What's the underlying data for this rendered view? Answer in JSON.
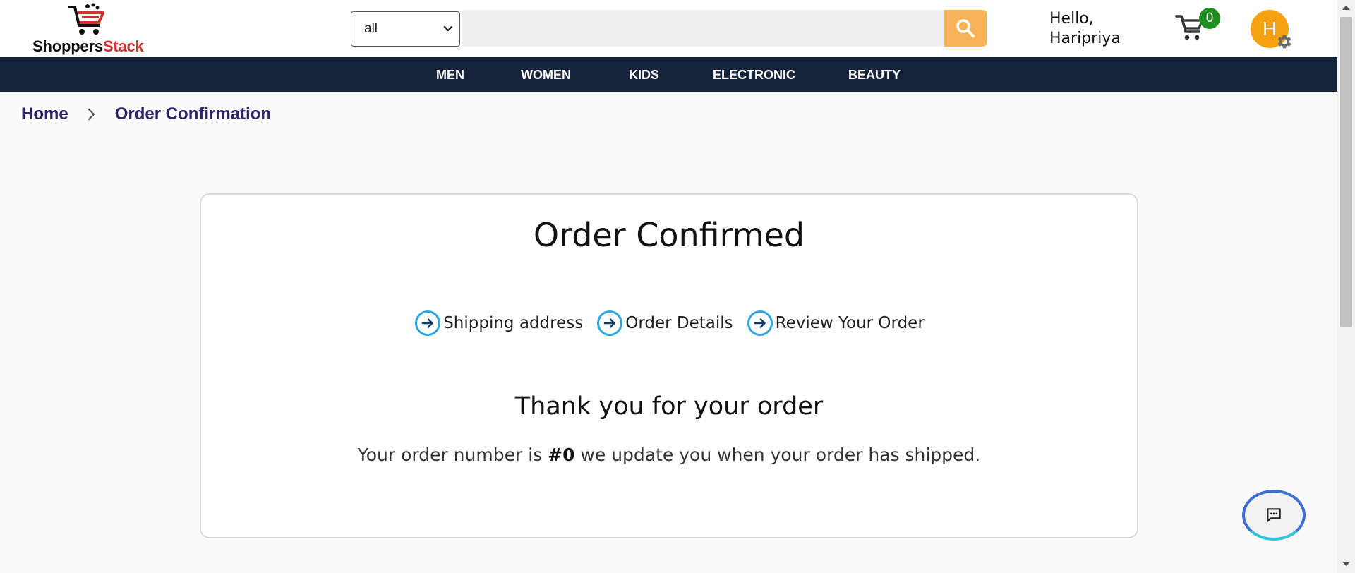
{
  "header": {
    "logo": {
      "text_part1": "Shoppers",
      "text_part2": "Stack",
      "icon": "cart-logo-icon"
    },
    "category_select": {
      "value": "all"
    },
    "search": {
      "placeholder": "",
      "button_icon": "search-icon"
    },
    "greeting": {
      "line1": "Hello,",
      "line2": "Haripriya"
    },
    "cart": {
      "count": "0",
      "icon": "cart-icon"
    },
    "avatar": {
      "initial": "H",
      "settings_icon": "gear-icon"
    }
  },
  "nav": {
    "items": [
      "MEN",
      "WOMEN",
      "KIDS",
      "ELECTRONIC",
      "BEAUTY"
    ]
  },
  "breadcrumb": {
    "home": "Home",
    "current": "Order Confirmation"
  },
  "card": {
    "title": "Order Confirmed",
    "steps": [
      "Shipping address",
      "Order Details",
      "Review Your Order"
    ],
    "thanks": "Thank you for your order",
    "order_prefix": "Your order number is",
    "order_number": "#0",
    "order_suffix": "we update you when your order has shipped."
  },
  "chat": {
    "icon": "chat-icon"
  },
  "colors": {
    "navbar": "#17233a",
    "search_button": "#f8b35a",
    "cart_badge": "#1e8f1e",
    "avatar": "#f6a012",
    "step_icon": "#29a8e0",
    "breadcrumb": "#2c2569",
    "logo_accent": "#d32f2f"
  }
}
